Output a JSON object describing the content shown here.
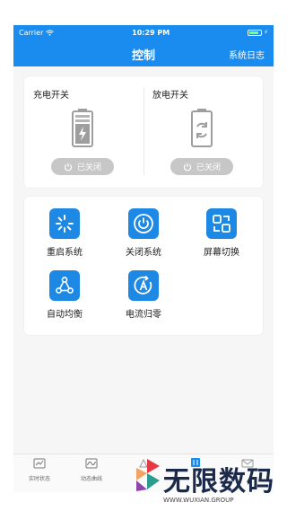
{
  "status_bar": {
    "carrier": "Carrier",
    "time": "10:29 PM"
  },
  "nav": {
    "title": "控制",
    "right_label": "系统日志"
  },
  "switches": [
    {
      "label": "充电开关",
      "state_label": "已关闭",
      "icon": "charging-battery-icon"
    },
    {
      "label": "放电开关",
      "state_label": "已关闭",
      "icon": "discharge-battery-icon"
    }
  ],
  "features": [
    {
      "label": "重启系统",
      "icon": "restart-icon"
    },
    {
      "label": "关闭系统",
      "icon": "power-icon"
    },
    {
      "label": "屏幕切换",
      "icon": "screen-switch-icon"
    },
    {
      "label": "自动均衡",
      "icon": "balance-icon"
    },
    {
      "label": "电流归零",
      "icon": "current-zero-icon"
    }
  ],
  "tabs": [
    {
      "label": "实时状态",
      "icon": "realtime-status-icon"
    },
    {
      "label": "动态曲线",
      "icon": "dynamic-curve-icon"
    }
  ],
  "watermark": {
    "title": "无限数码",
    "subtitle": "WWW.WUXIAN.GROUP"
  },
  "colors": {
    "accent": "#1a8cf0",
    "icon_bg": "#1e88e5",
    "pill": "#c7c7c7"
  }
}
